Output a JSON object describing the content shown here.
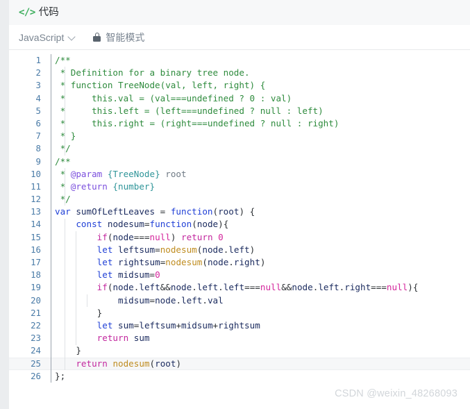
{
  "header": {
    "icon": "code-icon",
    "title": "代码"
  },
  "toolbar": {
    "language": "JavaScript",
    "chevron_icon": "chevron-down-icon",
    "lock_icon": "lock-icon",
    "mode_label": "智能模式"
  },
  "editor": {
    "language_mode": "JavaScript",
    "total_lines": 26,
    "active_line": 25,
    "lines": [
      {
        "n": "1",
        "tokens": [
          {
            "t": "/**",
            "c": "cmt"
          }
        ]
      },
      {
        "n": "2",
        "tokens": [
          {
            "t": " * Definition for a binary tree node.",
            "c": "cmt"
          }
        ]
      },
      {
        "n": "3",
        "tokens": [
          {
            "t": " * function TreeNode(val, left, right) {",
            "c": "cmt"
          }
        ]
      },
      {
        "n": "4",
        "tokens": [
          {
            "t": " *     this.val = (val===undefined ? 0 : val)",
            "c": "cmt"
          }
        ]
      },
      {
        "n": "5",
        "tokens": [
          {
            "t": " *     this.left = (left===undefined ? null : left)",
            "c": "cmt"
          }
        ]
      },
      {
        "n": "6",
        "tokens": [
          {
            "t": " *     this.right = (right===undefined ? null : right)",
            "c": "cmt"
          }
        ]
      },
      {
        "n": "7",
        "tokens": [
          {
            "t": " * }",
            "c": "cmt"
          }
        ]
      },
      {
        "n": "8",
        "tokens": [
          {
            "t": " */",
            "c": "cmt"
          }
        ]
      },
      {
        "n": "9",
        "tokens": [
          {
            "t": "/**",
            "c": "cmt"
          }
        ]
      },
      {
        "n": "10",
        "tokens": [
          {
            "t": " * ",
            "c": "cmt"
          },
          {
            "t": "@param",
            "c": "tag"
          },
          {
            "t": " ",
            "c": "cmt"
          },
          {
            "t": "{TreeNode}",
            "c": "typ"
          },
          {
            "t": " root",
            "c": "gry"
          }
        ]
      },
      {
        "n": "11",
        "tokens": [
          {
            "t": " * ",
            "c": "cmt"
          },
          {
            "t": "@return",
            "c": "tag"
          },
          {
            "t": " ",
            "c": "cmt"
          },
          {
            "t": "{number}",
            "c": "typ"
          }
        ]
      },
      {
        "n": "12",
        "tokens": [
          {
            "t": " */",
            "c": "cmt"
          }
        ]
      },
      {
        "n": "13",
        "tokens": [
          {
            "t": "var",
            "c": "kwb"
          },
          {
            "t": " ",
            "c": "pl"
          },
          {
            "t": "sumOfLeftLeaves",
            "c": "id"
          },
          {
            "t": " = ",
            "c": "pl"
          },
          {
            "t": "function",
            "c": "kwb"
          },
          {
            "t": "(",
            "c": "pl"
          },
          {
            "t": "root",
            "c": "id"
          },
          {
            "t": ") {",
            "c": "pl"
          }
        ]
      },
      {
        "n": "14",
        "tokens": [
          {
            "t": "    ",
            "c": "pl"
          },
          {
            "t": "const",
            "c": "kwb"
          },
          {
            "t": " ",
            "c": "pl"
          },
          {
            "t": "nodesum",
            "c": "id"
          },
          {
            "t": "=",
            "c": "pl"
          },
          {
            "t": "function",
            "c": "kwb"
          },
          {
            "t": "(",
            "c": "pl"
          },
          {
            "t": "node",
            "c": "id"
          },
          {
            "t": "){",
            "c": "pl"
          }
        ]
      },
      {
        "n": "15",
        "tokens": [
          {
            "t": "        ",
            "c": "pl"
          },
          {
            "t": "if",
            "c": "kw"
          },
          {
            "t": "(",
            "c": "pl"
          },
          {
            "t": "node",
            "c": "id"
          },
          {
            "t": "===",
            "c": "pl"
          },
          {
            "t": "null",
            "c": "lit"
          },
          {
            "t": ") ",
            "c": "pl"
          },
          {
            "t": "return",
            "c": "kw"
          },
          {
            "t": " ",
            "c": "pl"
          },
          {
            "t": "0",
            "c": "lit"
          }
        ]
      },
      {
        "n": "16",
        "tokens": [
          {
            "t": "        ",
            "c": "pl"
          },
          {
            "t": "let",
            "c": "kwb"
          },
          {
            "t": " ",
            "c": "pl"
          },
          {
            "t": "leftsum",
            "c": "id"
          },
          {
            "t": "=",
            "c": "pl"
          },
          {
            "t": "nodesum",
            "c": "fn"
          },
          {
            "t": "(",
            "c": "pl"
          },
          {
            "t": "node",
            "c": "id"
          },
          {
            "t": ".",
            "c": "pl"
          },
          {
            "t": "left",
            "c": "id"
          },
          {
            "t": ")",
            "c": "pl"
          }
        ]
      },
      {
        "n": "17",
        "tokens": [
          {
            "t": "        ",
            "c": "pl"
          },
          {
            "t": "let",
            "c": "kwb"
          },
          {
            "t": " ",
            "c": "pl"
          },
          {
            "t": "rightsum",
            "c": "id"
          },
          {
            "t": "=",
            "c": "pl"
          },
          {
            "t": "nodesum",
            "c": "fn"
          },
          {
            "t": "(",
            "c": "pl"
          },
          {
            "t": "node",
            "c": "id"
          },
          {
            "t": ".",
            "c": "pl"
          },
          {
            "t": "right",
            "c": "id"
          },
          {
            "t": ")",
            "c": "pl"
          }
        ]
      },
      {
        "n": "18",
        "tokens": [
          {
            "t": "        ",
            "c": "pl"
          },
          {
            "t": "let",
            "c": "kwb"
          },
          {
            "t": " ",
            "c": "pl"
          },
          {
            "t": "midsum",
            "c": "id"
          },
          {
            "t": "=",
            "c": "pl"
          },
          {
            "t": "0",
            "c": "lit"
          }
        ]
      },
      {
        "n": "19",
        "tokens": [
          {
            "t": "        ",
            "c": "pl"
          },
          {
            "t": "if",
            "c": "kw"
          },
          {
            "t": "(",
            "c": "pl"
          },
          {
            "t": "node",
            "c": "id"
          },
          {
            "t": ".",
            "c": "pl"
          },
          {
            "t": "left",
            "c": "id"
          },
          {
            "t": "&&",
            "c": "pl"
          },
          {
            "t": "node",
            "c": "id"
          },
          {
            "t": ".",
            "c": "pl"
          },
          {
            "t": "left",
            "c": "id"
          },
          {
            "t": ".",
            "c": "pl"
          },
          {
            "t": "left",
            "c": "id"
          },
          {
            "t": "===",
            "c": "pl"
          },
          {
            "t": "null",
            "c": "lit"
          },
          {
            "t": "&&",
            "c": "pl"
          },
          {
            "t": "node",
            "c": "id"
          },
          {
            "t": ".",
            "c": "pl"
          },
          {
            "t": "left",
            "c": "id"
          },
          {
            "t": ".",
            "c": "pl"
          },
          {
            "t": "right",
            "c": "id"
          },
          {
            "t": "===",
            "c": "pl"
          },
          {
            "t": "null",
            "c": "lit"
          },
          {
            "t": "){",
            "c": "pl"
          }
        ]
      },
      {
        "n": "20",
        "tokens": [
          {
            "t": "            ",
            "c": "pl"
          },
          {
            "t": "midsum",
            "c": "id"
          },
          {
            "t": "=",
            "c": "pl"
          },
          {
            "t": "node",
            "c": "id"
          },
          {
            "t": ".",
            "c": "pl"
          },
          {
            "t": "left",
            "c": "id"
          },
          {
            "t": ".",
            "c": "pl"
          },
          {
            "t": "val",
            "c": "id"
          }
        ]
      },
      {
        "n": "21",
        "tokens": [
          {
            "t": "        }",
            "c": "pl"
          }
        ]
      },
      {
        "n": "22",
        "tokens": [
          {
            "t": "        ",
            "c": "pl"
          },
          {
            "t": "let",
            "c": "kwb"
          },
          {
            "t": " ",
            "c": "pl"
          },
          {
            "t": "sum",
            "c": "id"
          },
          {
            "t": "=",
            "c": "pl"
          },
          {
            "t": "leftsum",
            "c": "id"
          },
          {
            "t": "+",
            "c": "pl"
          },
          {
            "t": "midsum",
            "c": "id"
          },
          {
            "t": "+",
            "c": "pl"
          },
          {
            "t": "rightsum",
            "c": "id"
          }
        ]
      },
      {
        "n": "23",
        "tokens": [
          {
            "t": "        ",
            "c": "pl"
          },
          {
            "t": "return",
            "c": "kw"
          },
          {
            "t": " ",
            "c": "pl"
          },
          {
            "t": "sum",
            "c": "id"
          }
        ]
      },
      {
        "n": "24",
        "tokens": [
          {
            "t": "    }",
            "c": "pl"
          }
        ]
      },
      {
        "n": "25",
        "tokens": [
          {
            "t": "    ",
            "c": "pl"
          },
          {
            "t": "return",
            "c": "kw"
          },
          {
            "t": " ",
            "c": "pl"
          },
          {
            "t": "nodesum",
            "c": "fn"
          },
          {
            "t": "(",
            "c": "pl"
          },
          {
            "t": "root",
            "c": "id"
          },
          {
            "t": ")",
            "c": "pl"
          }
        ]
      },
      {
        "n": "26",
        "tokens": [
          {
            "t": "};",
            "c": "pl"
          }
        ]
      }
    ]
  },
  "watermark": {
    "text": "CSDN @weixin_48268093"
  },
  "colors": {
    "comment": "#2e8b3d",
    "keyword_magenta": "#c2279e",
    "keyword_blue": "#1f3fd6",
    "identifier": "#1a2a5e",
    "function_name": "#bf8c1f",
    "literal": "#d4269c",
    "jsdoc_tag": "#7b4fdd",
    "jsdoc_type": "#2f9599",
    "line_number": "#4a7ba7",
    "header_bg": "#f7f8f9",
    "accent_green": "#3eaf5e"
  }
}
